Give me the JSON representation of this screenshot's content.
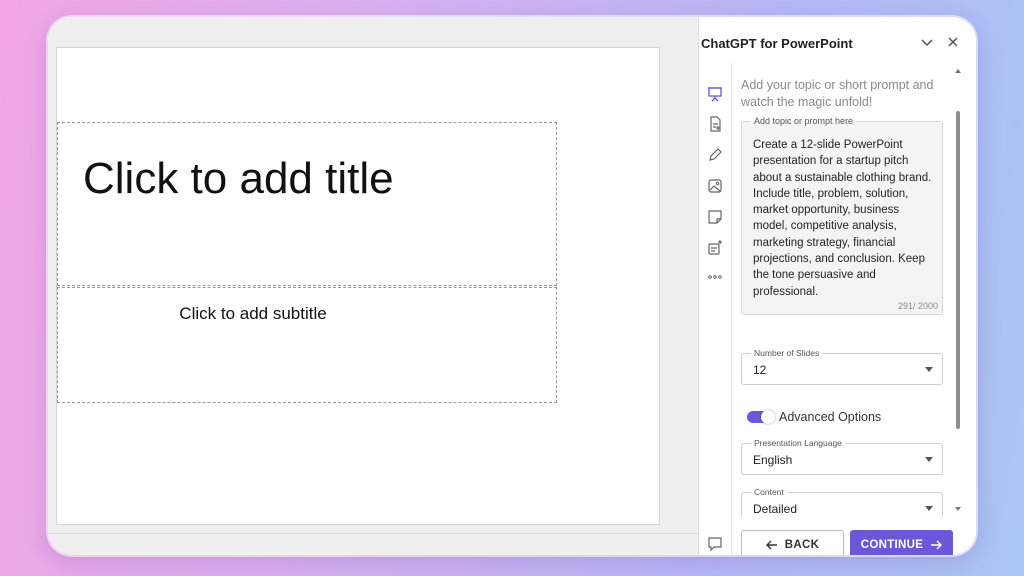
{
  "slide": {
    "title_placeholder": "Click to add title",
    "subtitle_placeholder": "Click to add subtitle"
  },
  "panel": {
    "title": "ChatGPT for PowerPoint",
    "header_icons": [
      "chevron-down-icon",
      "close-icon"
    ],
    "rail_icons": [
      "presentation-icon",
      "document-add-icon",
      "pencil-icon",
      "image-icon",
      "sticky-note-icon",
      "edit-list-icon",
      "more-icon"
    ],
    "intro": "Add your topic or short prompt and watch the magic unfold!",
    "prompt": {
      "label": "Add topic or prompt here",
      "value": "Create a 12-slide PowerPoint presentation for a startup pitch about a sustainable clothing brand. Include title, problem, solution, market opportunity, business model, competitive analysis, marketing strategy, financial projections, and conclusion. Keep the tone persuasive and professional.",
      "counter": "291/ 2000"
    },
    "slides_count": {
      "label": "Number of Slides",
      "value": "12"
    },
    "advanced_toggle": {
      "label": "Advanced Options",
      "on": true
    },
    "language": {
      "label": "Presentation Language",
      "value": "English"
    },
    "content_level": {
      "label": "Content",
      "value": "Detailed"
    },
    "buttons": {
      "back": "BACK",
      "continue": "CONTINUE"
    },
    "accent_color": "#6b57d8"
  }
}
